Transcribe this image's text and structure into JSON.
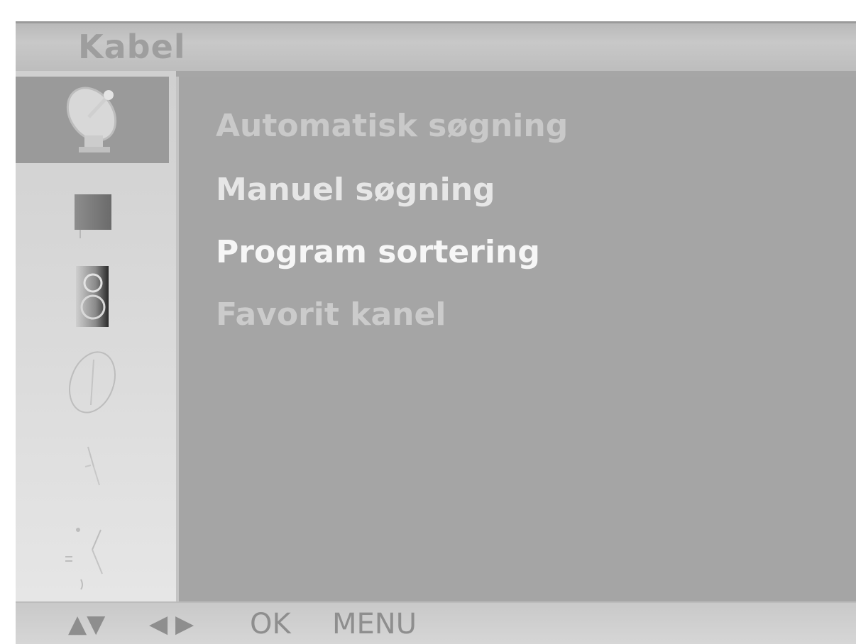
{
  "header": {
    "title": "Kabel"
  },
  "sidebar": {
    "items": [
      {
        "icon": "satellite-dish-icon",
        "active": true
      },
      {
        "icon": "picture-icon",
        "active": false
      },
      {
        "icon": "speaker-icon",
        "active": false
      },
      {
        "icon": "clock-icon",
        "active": false
      },
      {
        "icon": "special-icon",
        "active": false
      },
      {
        "icon": "setup-icon",
        "active": false
      }
    ]
  },
  "menu": {
    "items": [
      {
        "label": "Automatisk søgning",
        "color": "#c9c9c9"
      },
      {
        "label": "Manuel søgning",
        "color": "#e6e6e6"
      },
      {
        "label": "Program sortering",
        "color": "#f6f6f6"
      },
      {
        "label": "Favorit kanel",
        "color": "#cbcbcb"
      }
    ]
  },
  "footer": {
    "up_down": "▲▼",
    "left_right": "◀ ▶",
    "ok": "OK",
    "menu": "MENU"
  },
  "colors": {
    "panel": "#a5a5a5",
    "sidebar": "#d6d6d6",
    "active_sidebar_item": "#9a9a9a",
    "title_text": "#9e9e9e"
  }
}
